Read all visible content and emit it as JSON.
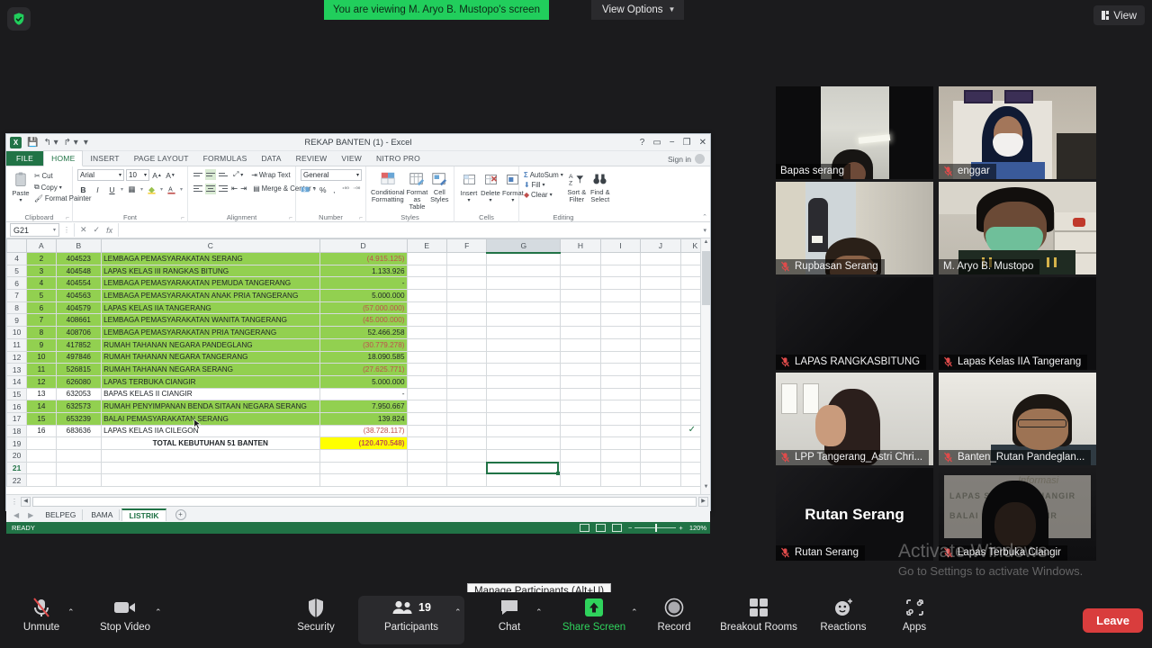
{
  "topbar": {
    "security_icon": "shield-check-icon",
    "viewing_banner": "You are viewing M. Aryo B. Mustopo's screen",
    "view_options_label": "View Options",
    "view_button_label": "View",
    "banner_color": "#21ce5c"
  },
  "excel": {
    "title": "REKAP BANTEN (1) - Excel",
    "logo": "X",
    "quick_access": [
      "save-icon",
      "undo-icon",
      "redo-icon",
      "customize-icon"
    ],
    "window_controls": [
      "help-icon",
      "ribbon-display-icon",
      "minimize-icon",
      "restore-icon",
      "close-icon"
    ],
    "file_tab": "FILE",
    "tabs": [
      "HOME",
      "INSERT",
      "PAGE LAYOUT",
      "FORMULAS",
      "DATA",
      "REVIEW",
      "VIEW",
      "NITRO PRO"
    ],
    "active_tab": "HOME",
    "signin": "Sign in",
    "ribbon": {
      "clipboard": {
        "label": "Clipboard",
        "paste": "Paste",
        "cut": "Cut",
        "copy": "Copy",
        "format_painter": "Format Painter"
      },
      "font": {
        "label": "Font",
        "font_name": "Arial",
        "font_size": "10",
        "grow": "A",
        "shrink": "A",
        "bold": "B",
        "italic": "I",
        "underline": "U"
      },
      "alignment": {
        "label": "Alignment",
        "wrap_text": "Wrap Text",
        "merge_center": "Merge & Center"
      },
      "number": {
        "label": "Number",
        "format": "General",
        "percent": "%",
        "comma": ","
      },
      "styles": {
        "label": "Styles",
        "conditional_formatting": "Conditional Formatting",
        "format_as_table": "Format as Table",
        "cell_styles": "Cell Styles"
      },
      "cells": {
        "label": "Cells",
        "insert": "Insert",
        "delete": "Delete",
        "format": "Format"
      },
      "editing": {
        "label": "Editing",
        "autosum": "AutoSum",
        "fill": "Fill",
        "clear": "Clear",
        "sort_filter": "Sort & Filter",
        "find_select": "Find & Select"
      }
    },
    "formula_bar": {
      "name_box": "G21",
      "formula_value": "",
      "cancel": "✕",
      "enter": "✓",
      "fx": "fx"
    },
    "grid": {
      "column_headers": [
        "A",
        "B",
        "C",
        "D",
        "E",
        "F",
        "G",
        "H",
        "I",
        "J",
        "K"
      ],
      "selected_column": "G",
      "selected_cell": "G21",
      "rows": [
        {
          "row": "4",
          "a": "2",
          "b": "404523",
          "c": "LEMBAGA PEMASYARAKATAN SERANG",
          "d": "(4.915.125)",
          "green": true,
          "negative": true
        },
        {
          "row": "5",
          "a": "3",
          "b": "404548",
          "c": "LAPAS KELAS III RANGKAS BITUNG",
          "d": "1.133.926",
          "green": true,
          "negative": false
        },
        {
          "row": "6",
          "a": "4",
          "b": "404554",
          "c": "LEMBAGA PEMASYARAKATAN PEMUDA TANGERANG",
          "d": "-",
          "green": true,
          "negative": false
        },
        {
          "row": "7",
          "a": "5",
          "b": "404563",
          "c": "LEMBAGA PEMASYARAKATAN ANAK PRIA TANGERANG",
          "d": "5.000.000",
          "green": true,
          "negative": false
        },
        {
          "row": "8",
          "a": "6",
          "b": "404579",
          "c": "LAPAS KELAS IIA TANGERANG",
          "d": "(57.000.000)",
          "green": true,
          "negative": true
        },
        {
          "row": "9",
          "a": "7",
          "b": "408661",
          "c": "LEMBAGA PEMASYARAKATAN WANITA TANGERANG",
          "d": "(45.000.000)",
          "green": true,
          "negative": true
        },
        {
          "row": "10",
          "a": "8",
          "b": "408706",
          "c": "LEMBAGA PEMASYARAKATAN PRIA TANGERANG",
          "d": "52.466.258",
          "green": true,
          "negative": false
        },
        {
          "row": "11",
          "a": "9",
          "b": "417852",
          "c": "RUMAH TAHANAN NEGARA PANDEGLANG",
          "d": "(30.779.278)",
          "green": true,
          "negative": true
        },
        {
          "row": "12",
          "a": "10",
          "b": "497846",
          "c": "RUMAH TAHANAN NEGARA TANGERANG",
          "d": "18.090.585",
          "green": true,
          "negative": false
        },
        {
          "row": "13",
          "a": "11",
          "b": "526815",
          "c": "RUMAH TAHANAN NEGARA SERANG",
          "d": "(27.625.771)",
          "green": true,
          "negative": true
        },
        {
          "row": "14",
          "a": "12",
          "b": "626080",
          "c": "LAPAS TERBUKA CIANGIR",
          "d": "5.000.000",
          "green": true,
          "negative": false
        },
        {
          "row": "15",
          "a": "13",
          "b": "632053",
          "c": "BAPAS KELAS II CIANGIR",
          "d": "-",
          "green": false,
          "negative": false
        },
        {
          "row": "16",
          "a": "14",
          "b": "632573",
          "c": "RUMAH PENYIMPANAN BENDA SITAAN NEGARA SERANG",
          "d": "7.950.667",
          "green": true,
          "negative": false
        },
        {
          "row": "17",
          "a": "15",
          "b": "653239",
          "c": "BALAI PEMASYARAKATAN SERANG",
          "d": "139.824",
          "green": true,
          "negative": false
        },
        {
          "row": "18",
          "a": "16",
          "b": "683636",
          "c": "LAPAS KELAS IIA CILEGON",
          "d": "(38.728.117)",
          "green": false,
          "negative": true
        },
        {
          "row": "19",
          "a": "",
          "b": "",
          "c": "TOTAL KEBUTUHAN 51 BANTEN",
          "d": "(120.470.548)",
          "green": false,
          "negative": true,
          "total": true
        },
        {
          "row": "20",
          "a": "",
          "b": "",
          "c": "",
          "d": "",
          "green": false,
          "negative": false
        },
        {
          "row": "21",
          "a": "",
          "b": "",
          "c": "",
          "d": "",
          "green": false,
          "negative": false
        },
        {
          "row": "22",
          "a": "",
          "b": "",
          "c": "",
          "d": "",
          "green": false,
          "negative": false
        }
      ]
    },
    "sheet_tabs": [
      "BELPEG",
      "BAMA",
      "LISTRIK"
    ],
    "active_sheet": "LISTRIK",
    "add_sheet": "+",
    "status_text": "READY",
    "zoom_level": "120%",
    "view_buttons": [
      "normal-view-icon",
      "page-layout-icon",
      "page-break-icon"
    ]
  },
  "participants": [
    {
      "name": "Bapas serang",
      "muted": false,
      "active": false,
      "style": "ph-bapas",
      "big_name": ""
    },
    {
      "name": "enggar",
      "muted": true,
      "active": false,
      "style": "ph-enggar",
      "big_name": ""
    },
    {
      "name": "Rupbasan Serang",
      "muted": true,
      "active": false,
      "style": "ph-rupbasan",
      "big_name": ""
    },
    {
      "name": "M. Aryo B. Mustopo",
      "muted": false,
      "active": true,
      "style": "ph-aryo",
      "big_name": ""
    },
    {
      "name": "LAPAS RANGKASBITUNG",
      "muted": true,
      "active": false,
      "style": "ph-dark",
      "big_name": ""
    },
    {
      "name": "Lapas Kelas IIA Tangerang",
      "muted": true,
      "active": false,
      "style": "ph-dark",
      "big_name": ""
    },
    {
      "name": "LPP Tangerang_Astri Chri...",
      "muted": true,
      "active": false,
      "style": "ph-lpp",
      "big_name": ""
    },
    {
      "name": "Banten_Rutan Pandeglan...",
      "muted": true,
      "active": false,
      "style": "ph-pandeglang",
      "big_name": ""
    },
    {
      "name": "Rutan Serang",
      "muted": true,
      "active": false,
      "style": "ph-dark",
      "big_name": "Rutan Serang"
    },
    {
      "name": "Lapas Terbuka Ciangir",
      "muted": true,
      "active": false,
      "style": "ph-ciangir",
      "big_name": ""
    }
  ],
  "watermark": {
    "line1": "Activate Windows",
    "line2": "Go to Settings to activate Windows."
  },
  "tooltip": "Manage Participants (Alt+U)",
  "controls": [
    {
      "label": "Unmute",
      "icon": "mic-muted-icon",
      "chevron": true,
      "green": false,
      "highlight": false
    },
    {
      "label": "Stop Video",
      "icon": "video-camera-icon",
      "chevron": true,
      "green": false,
      "highlight": false
    },
    {
      "label": "Security",
      "icon": "shield-icon",
      "chevron": false,
      "green": false,
      "highlight": false
    },
    {
      "label": "Participants",
      "icon": "people-icon",
      "chevron": true,
      "green": false,
      "highlight": true,
      "count": "19"
    },
    {
      "label": "Chat",
      "icon": "chat-bubble-icon",
      "chevron": true,
      "green": false,
      "highlight": false
    },
    {
      "label": "Share Screen",
      "icon": "share-screen-icon",
      "chevron": true,
      "green": true,
      "highlight": false
    },
    {
      "label": "Record",
      "icon": "record-icon",
      "chevron": false,
      "green": false,
      "highlight": false
    },
    {
      "label": "Breakout Rooms",
      "icon": "breakout-rooms-icon",
      "chevron": false,
      "green": false,
      "highlight": false
    },
    {
      "label": "Reactions",
      "icon": "reactions-icon",
      "chevron": false,
      "green": false,
      "highlight": false
    },
    {
      "label": "Apps",
      "icon": "apps-icon",
      "chevron": false,
      "green": false,
      "highlight": false
    }
  ],
  "leave_button": "Leave",
  "ciangir_board": {
    "line1": "LAPAS  SECURITY  CIANGIR",
    "line2": "BALAI  KAYAN  CIANGIR",
    "script": "Informasi"
  }
}
